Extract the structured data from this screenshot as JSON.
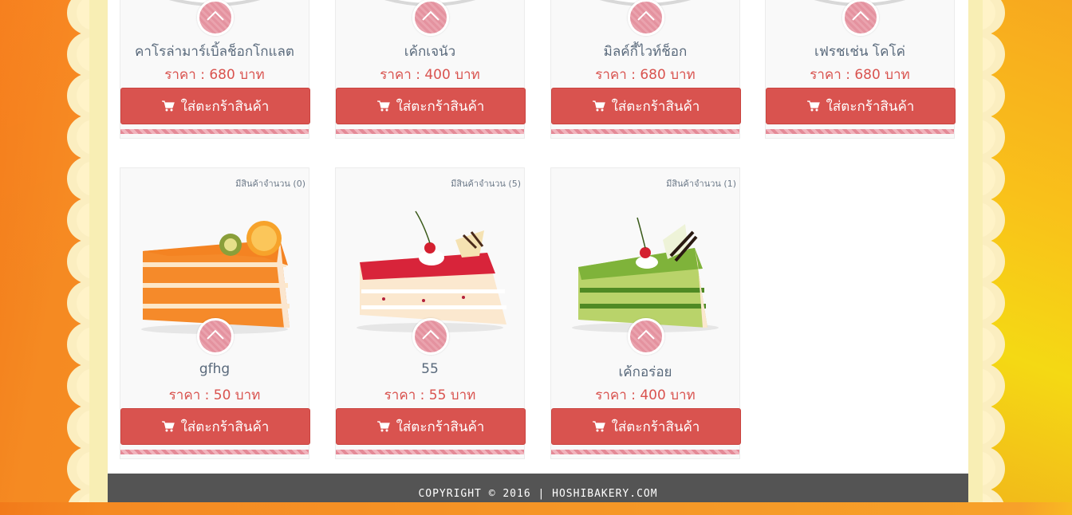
{
  "row1": [
    {
      "name": "คาโรล่ามาร์เบิ้ลช็อกโกแลต",
      "price": "ราคา : 680 บาท",
      "button": "ใส่ตะกร้าสินค้า"
    },
    {
      "name": "เค้กเจนัว",
      "price": "ราคา : 400 บาท",
      "button": "ใส่ตะกร้าสินค้า"
    },
    {
      "name": "มิลค์กี้ไวท์ช็อก",
      "price": "ราคา : 680 บาท",
      "button": "ใส่ตะกร้าสินค้า"
    },
    {
      "name": "เฟรชเช่น โคโค่",
      "price": "ราคา : 680 บาท",
      "button": "ใส่ตะกร้าสินค้า"
    }
  ],
  "row2": [
    {
      "stock": "มีสินค้าจำนวน (0)",
      "image": "orange-cake-slice",
      "name": "gfhg",
      "price": "ราคา : 50 บาท",
      "button": "ใส่ตะกร้าสินค้า"
    },
    {
      "stock": "มีสินค้าจำนวน (5)",
      "image": "strawberry-cake-slice",
      "name": "55",
      "price": "ราคา : 55 บาท",
      "button": "ใส่ตะกร้าสินค้า"
    },
    {
      "stock": "มีสินค้าจำนวน (1)",
      "image": "green-tea-cake-slice",
      "name": "เค้กอร่อย",
      "price": "ราคา : 400 บาท",
      "button": "ใส่ตะกร้าสินค้า"
    }
  ],
  "footer": {
    "copyright": "COPYRIGHT © 2016 | HOSHIBAKERY.COM"
  },
  "colors": {
    "accent": "#d9534f",
    "name_text": "#5a6a7c",
    "footer_bg": "#545454"
  }
}
